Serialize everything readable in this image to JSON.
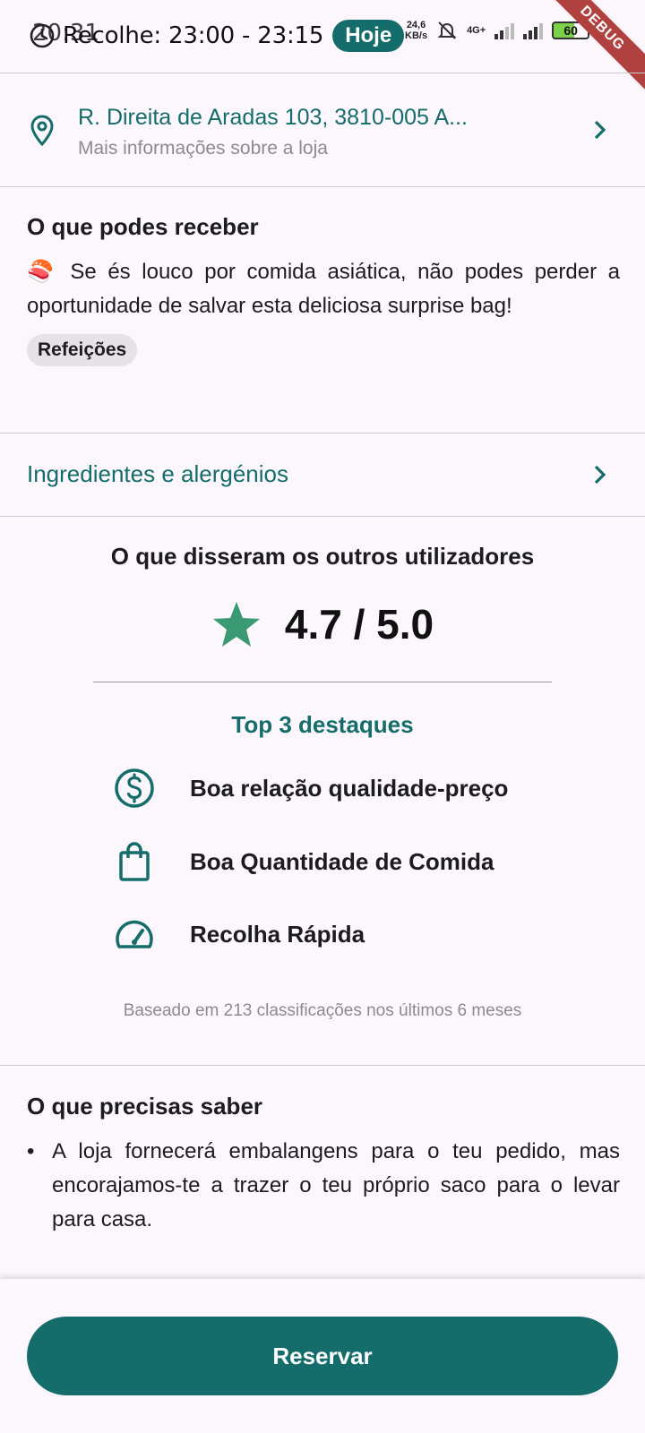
{
  "status_bar": {
    "time": "20:31",
    "net_speed_value": "24,6",
    "net_speed_unit": "KB/s",
    "network": "4G+",
    "battery": "60",
    "debug_label": "DEBUG"
  },
  "header": {
    "pickup_text": "Recolhe: 23:00 - 23:15",
    "day_badge": "Hoje"
  },
  "store": {
    "address": "R. Direita de Aradas 103, 3810-005 A...",
    "more_info": "Mais informações sobre a loja"
  },
  "receive": {
    "title": "O que podes receber",
    "emoji": "🍣",
    "description": " Se és louco por comida asiática, não podes perder a oportunidade de salvar esta deliciosa surprise bag!",
    "category_chip": "Refeições"
  },
  "ingredients": {
    "label": "Ingredientes e alergénios"
  },
  "reviews": {
    "title": "O que disseram os outros utilizadores",
    "score": "4.7 / 5.0",
    "top_title": "Top 3 destaques",
    "highlights": [
      {
        "icon": "dollar-circle-icon",
        "label": "Boa relação qualidade-preço"
      },
      {
        "icon": "shopping-bag-icon",
        "label": "Boa Quantidade de Comida"
      },
      {
        "icon": "speedometer-icon",
        "label": "Recolha Rápida"
      }
    ],
    "based_on": "Baseado em 213 classificações nos últimos 6 meses"
  },
  "need_to_know": {
    "title": "O que precisas saber",
    "bullet": "•",
    "items": [
      "A loja fornecerá embalangens para o teu pedido, mas encorajamos-te a trazer o teu próprio saco para o levar para casa."
    ]
  },
  "footer": {
    "reserve_label": "Reservar"
  },
  "colors": {
    "accent": "#146d6b",
    "star": "#3a9a73",
    "background": "#fcf7fc"
  }
}
